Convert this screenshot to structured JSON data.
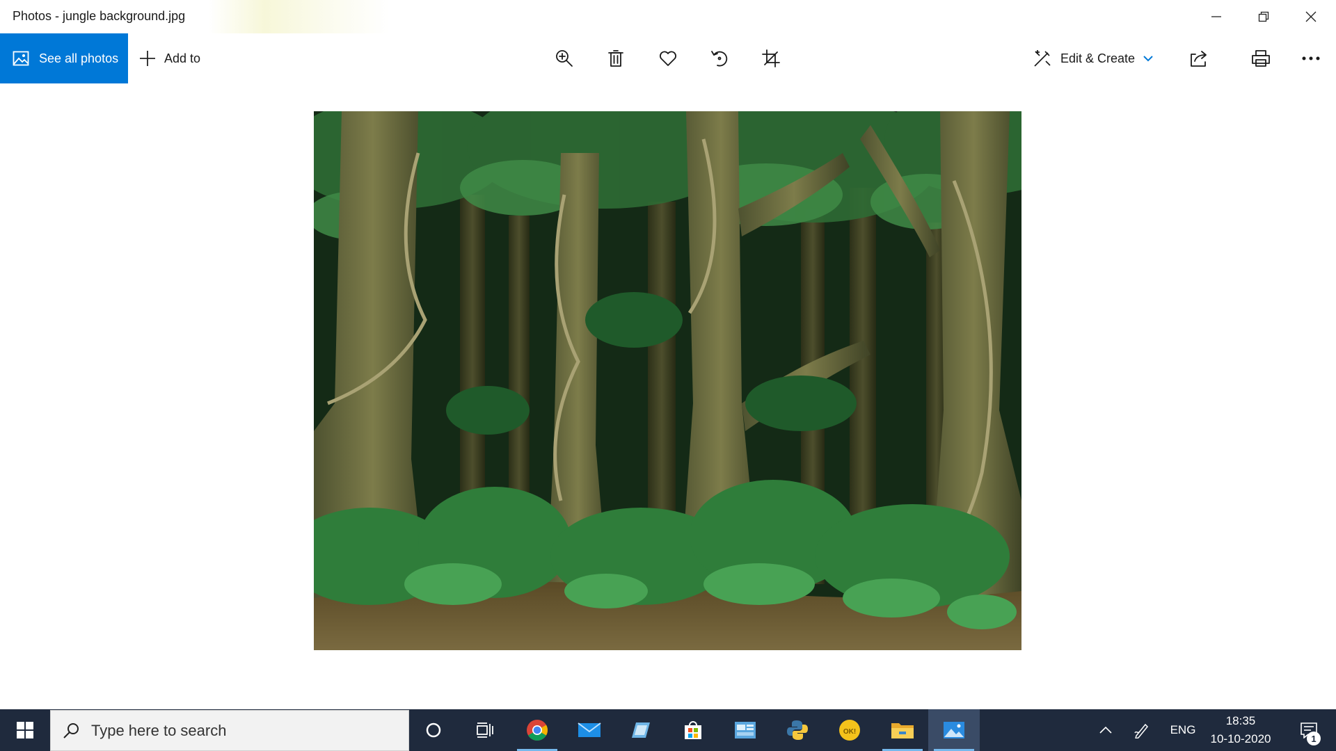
{
  "window": {
    "title": "Photos - jungle background.jpg",
    "controls": [
      "minimize-icon",
      "restore-icon",
      "close-icon"
    ]
  },
  "toolbar": {
    "see_all_photos": "See all photos",
    "add_to": "Add to",
    "tools": [
      "zoom-icon",
      "delete-icon",
      "favorite-icon",
      "rotate-icon",
      "crop-icon"
    ],
    "edit_create": "Edit & Create",
    "right_tools": [
      "share-icon",
      "print-icon",
      "more-icon"
    ],
    "accent_color": "#0078d7"
  },
  "viewer": {
    "expand_icon": "fullscreen-expand-icon"
  },
  "taskbar": {
    "search_placeholder": "Type here to search",
    "apps": [
      "cortana-icon",
      "task-view-icon",
      "chrome-icon",
      "mail-icon",
      "notepad-icon",
      "store-icon",
      "control-panel-icon",
      "python-icon",
      "okbar-icon",
      "file-explorer-icon",
      "photos-icon"
    ],
    "tray": {
      "language": "ENG",
      "time": "18:35",
      "date": "10-10-2020",
      "notification_count": "1"
    },
    "background_color": "#1f2a3d"
  }
}
